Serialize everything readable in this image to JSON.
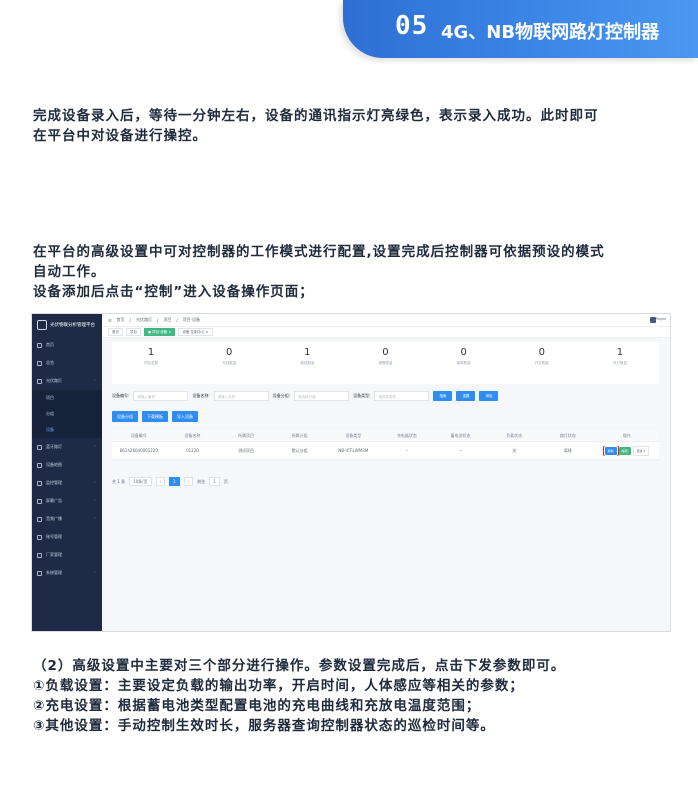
{
  "header": {
    "number": "05",
    "title": "4G、NB物联网路灯控制器"
  },
  "paragraph1": [
    "完成设备录入后，等待一分钟左右，设备的通讯指示灯亮绿色，表示录入成功。此时即可",
    "在平台中对设备进行操控。"
  ],
  "paragraph2": [
    "在平台的高级设置中可对控制器的工作模式进行配置,设置完成后控制器可依据预设的模式",
    "自动工作。",
    "设备添加后点击“控制”进入设备操作页面；"
  ],
  "paragraph3": [
    "（2）高级设置中主要对三个部分进行操作。参数设置完成后，点击下发参数即可。",
    "①负载设置：主要设定负载的输出功率，开启时间，人体感应等相关的参数；",
    "②充电设置：根据蓄电池类型配置电池的充电曲线和充放电温度范围；",
    "③其他设置：手动控制生效时长，服务器查询控制器状态的巡检时间等。"
  ],
  "screenshot": {
    "app_title": "光伏物联分析管理平台",
    "sidebar": {
      "items": [
        "首页",
        "总览",
        "光伏路灯",
        "蓝牙路灯",
        "设备地图",
        "监控管理",
        "屏幕广告",
        "音频广播",
        "账号管理",
        "厂家管理",
        "系统管理"
      ],
      "sub_items": [
        "项目",
        "分组",
        "设备"
      ]
    },
    "breadcrumb": [
      "首页",
      "光伏路灯",
      "项目",
      "项目·设备"
    ],
    "user": "Pagini",
    "tags": [
      "首页",
      "项目",
      "● 项目·设备 ×",
      "设备·控制中心 ×"
    ],
    "stats": [
      {
        "value": "1",
        "label": "项目总数"
      },
      {
        "value": "0",
        "label": "在线数量"
      },
      {
        "value": "1",
        "label": "离线数量"
      },
      {
        "value": "0",
        "label": "报警数量"
      },
      {
        "value": "0",
        "label": "故障数量"
      },
      {
        "value": "0",
        "label": "开灯数量"
      },
      {
        "value": "1",
        "label": "关灯数量"
      }
    ],
    "filters": {
      "label1": "设备编号:",
      "ph1": "请输入编号",
      "label2": "设备名称:",
      "ph2": "请输入名称",
      "label3": "设备分组:",
      "ph3": "请选择分组",
      "label4": "设备类型:",
      "ph4": "请选择类型",
      "search": "搜索",
      "reset": "重置",
      "add": "添加"
    },
    "actions": [
      "设备分组",
      "下载模板",
      "导入设备"
    ],
    "table": {
      "headers": [
        "设备编号",
        "设备名称",
        "所属项目",
        "所属分组",
        "设备类型",
        "充电器状态",
        "蓄电池状态",
        "负载状态",
        "路灯状态",
        "操作"
      ],
      "row": [
        "861426040001220",
        "01220",
        "测试项目",
        "默认分组",
        "NB-ICT-LWM3M",
        "--",
        "--",
        "关",
        "离线"
      ],
      "ops": [
        "控制",
        "编辑",
        "更多 ▾"
      ]
    },
    "pager": {
      "total": "共 1 条",
      "size": "10条/页",
      "page": "1",
      "goto": "前往",
      "goto_page": "1",
      "unit": "页"
    }
  }
}
